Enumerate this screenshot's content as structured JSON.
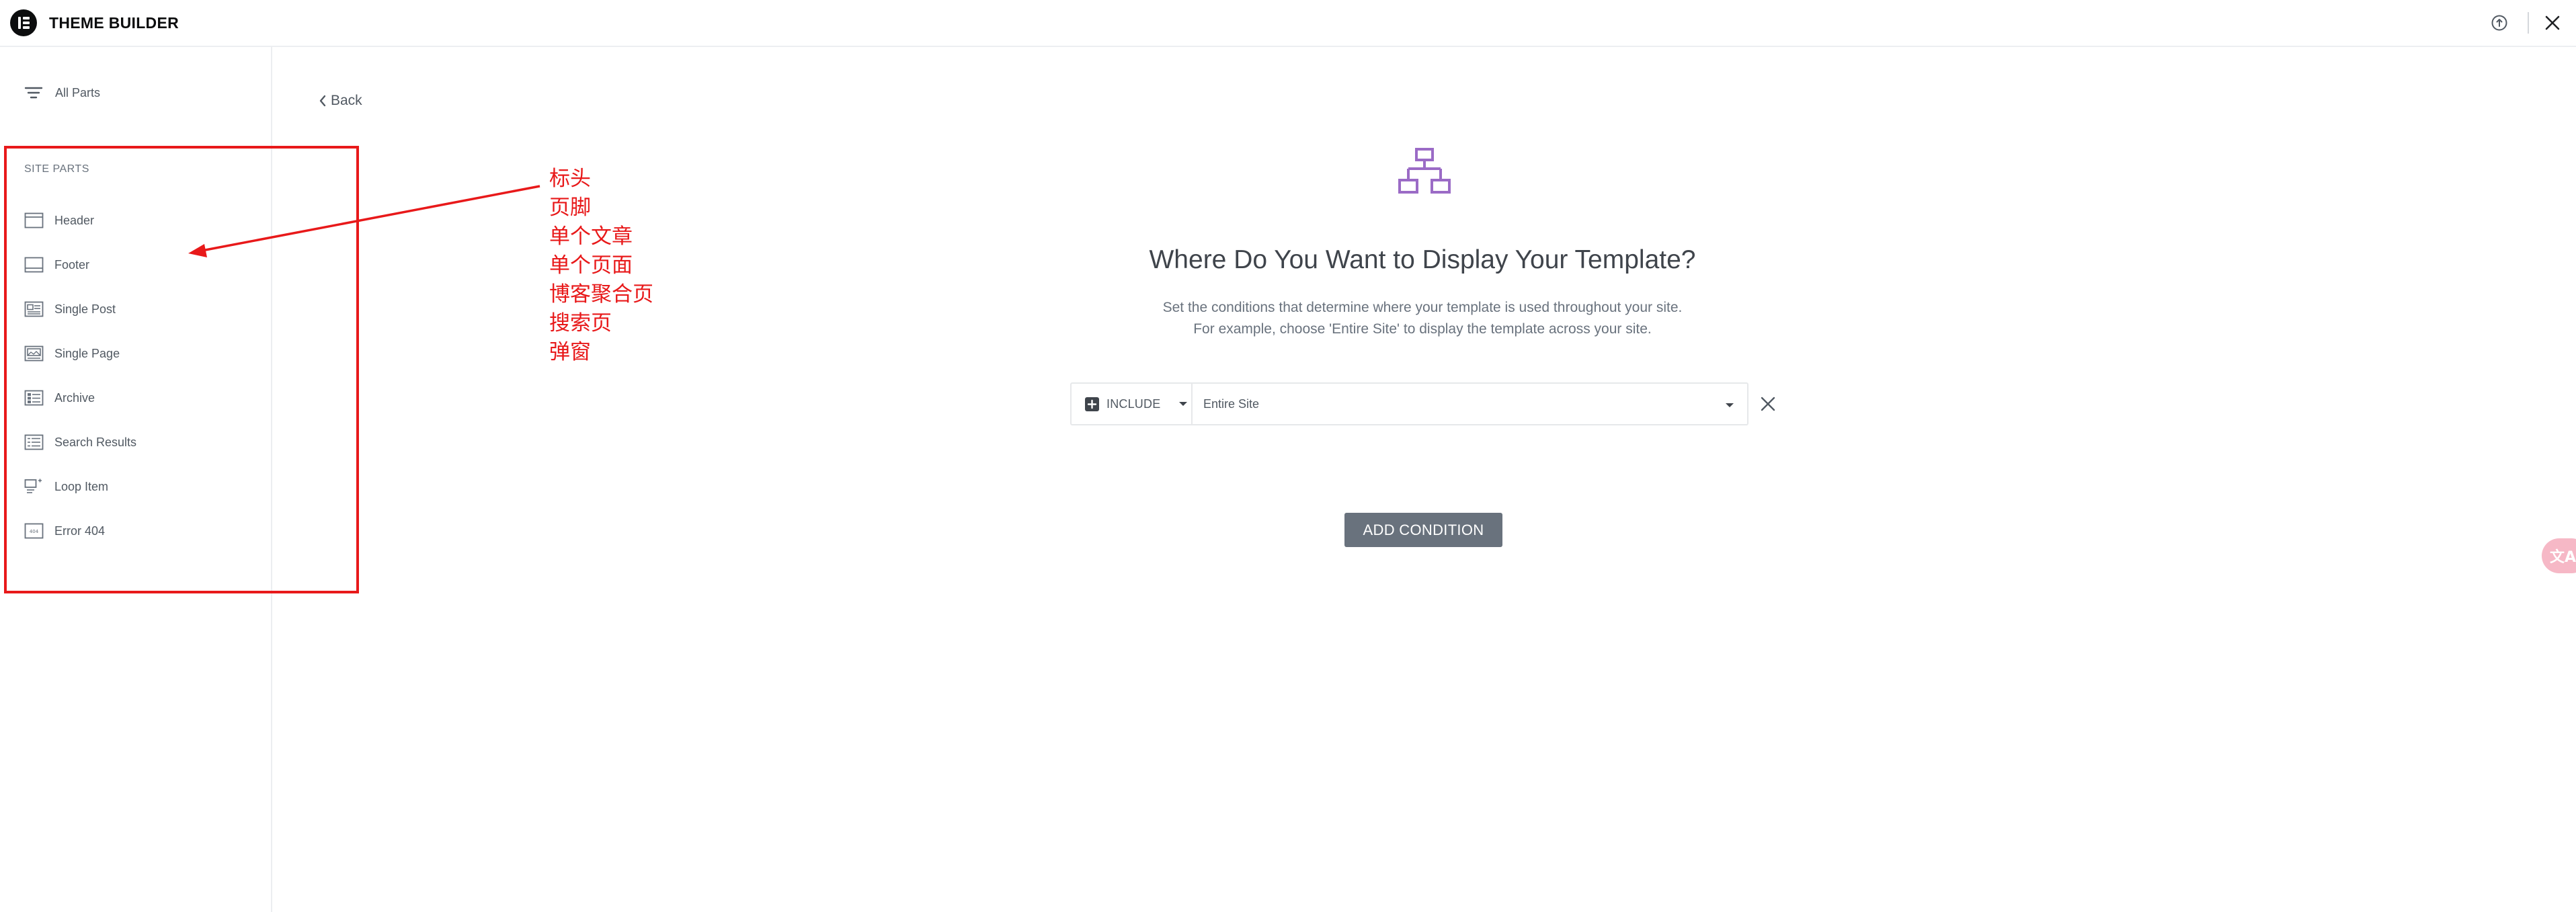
{
  "header": {
    "app_title": "THEME BUILDER",
    "logo_icon": "elementor-logo",
    "help_icon": "help-icon",
    "close_icon": "close-icon"
  },
  "sidebar": {
    "all_parts_label": "All Parts",
    "section_label": "SITE PARTS",
    "items": [
      {
        "label": "Header",
        "icon": "header-layout-icon"
      },
      {
        "label": "Footer",
        "icon": "footer-layout-icon"
      },
      {
        "label": "Single Post",
        "icon": "single-post-icon"
      },
      {
        "label": "Single Page",
        "icon": "single-page-icon"
      },
      {
        "label": "Archive",
        "icon": "archive-icon"
      },
      {
        "label": "Search Results",
        "icon": "search-results-icon"
      },
      {
        "label": "Loop Item",
        "icon": "loop-item-icon"
      },
      {
        "label": "Error 404",
        "icon": "error-404-icon"
      }
    ]
  },
  "annotation": {
    "color": "#e8191a",
    "lines": [
      "标头",
      "页脚",
      "单个文章",
      "单个页面",
      "博客聚合页",
      "搜索页",
      "弹窗"
    ]
  },
  "main": {
    "back_label": "Back",
    "title": "Where Do You Want to Display Your Template?",
    "subtitle_line1": "Set the conditions that determine where your template is used throughout your site.",
    "subtitle_line2": "For example, choose 'Entire Site' to display the template across your site.",
    "condition": {
      "type_label": "INCLUDE",
      "scope_label": "Entire Site"
    },
    "add_condition_label": "ADD CONDITION"
  },
  "floating": {
    "translate_label": "文A"
  },
  "colors": {
    "accent_purple": "#9b6bc6",
    "button_gray": "#69727d",
    "annotation_red": "#e8191a"
  }
}
